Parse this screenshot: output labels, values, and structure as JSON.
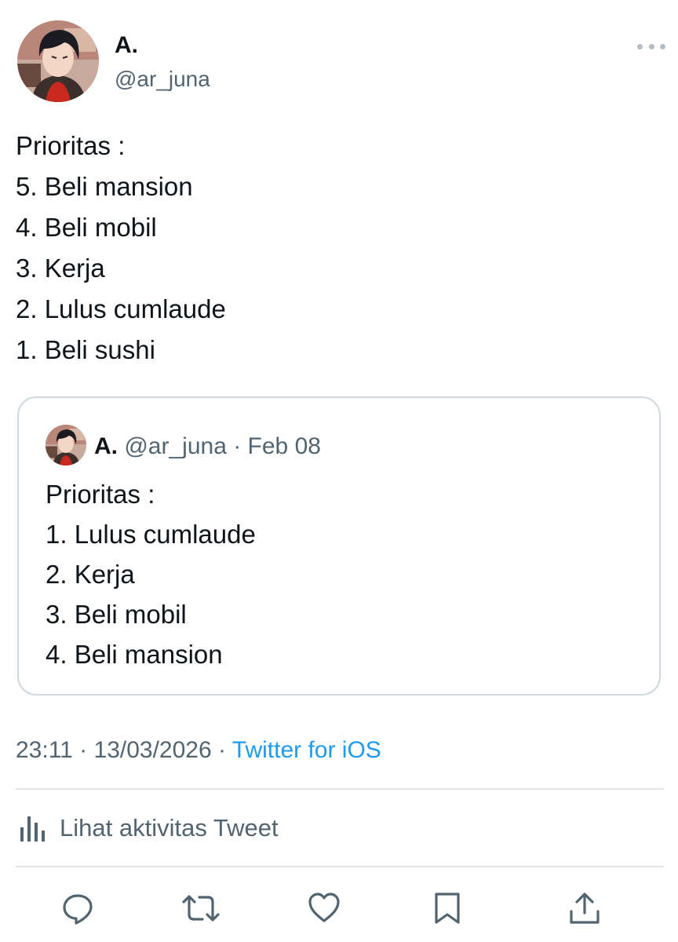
{
  "tweet": {
    "author_name": "A.",
    "author_handle": "@ar_juna",
    "text_lines": [
      "Prioritas :",
      "5. Beli mansion",
      "4. Beli mobil",
      "3. Kerja",
      "2. Lulus cumlaude",
      "1. Beli sushi"
    ],
    "timestamp": "23:11 · 13/03/2026 · ",
    "source": "Twitter for iOS",
    "activity_label": "Lihat aktivitas Tweet"
  },
  "quoted_tweet": {
    "author_name": "A.",
    "author_handle": "@ar_juna",
    "date": " · Feb 08",
    "text_lines": [
      "Prioritas :",
      "1. Lulus cumlaude",
      "2. Kerja",
      "3. Beli mobil",
      "4. Beli mansion"
    ]
  },
  "colors": {
    "accent": "#1d9bf0",
    "secondary_text": "#536471",
    "border": "#cfd9de"
  },
  "icons": {
    "more": "more-dots-icon",
    "activity": "bar-chart-icon",
    "reply": "reply-icon",
    "retweet": "retweet-icon",
    "like": "heart-icon",
    "bookmark": "bookmark-icon",
    "share": "share-icon"
  }
}
